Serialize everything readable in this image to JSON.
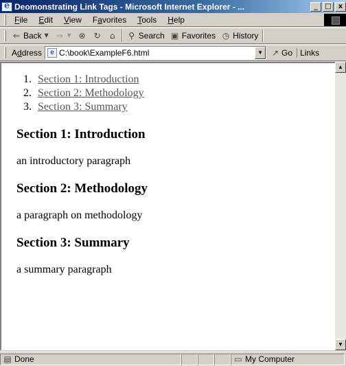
{
  "window": {
    "title": "Deomonstrating Link Tags - Microsoft Internet Explorer - ...",
    "controls": {
      "minimize": "_",
      "maximize": "□",
      "close": "x"
    }
  },
  "menu": {
    "items": [
      {
        "accel": "F",
        "rest": "ile"
      },
      {
        "accel": "E",
        "rest": "dit"
      },
      {
        "accel": "V",
        "rest": "iew"
      },
      {
        "pre": "F",
        "accel": "a",
        "rest": "vorites"
      },
      {
        "accel": "T",
        "rest": "ools"
      },
      {
        "accel": "H",
        "rest": "elp"
      }
    ]
  },
  "toolbar": {
    "back": "Back",
    "search": "Search",
    "favorites": "Favorites",
    "history": "History"
  },
  "address": {
    "label_accel": "d",
    "label_pre": "A",
    "label_rest": "dress",
    "value": "C:\\book\\ExampleF6.html",
    "go": "Go",
    "links": "Links"
  },
  "page": {
    "toc": [
      {
        "num": "1.",
        "label": "Section 1: Introduction"
      },
      {
        "num": "2.",
        "label": "Section 2: Methodology"
      },
      {
        "num": "3.",
        "label": "Section 3: Summary"
      }
    ],
    "sections": [
      {
        "heading": "Section 1: Introduction",
        "text": "an introductory paragraph"
      },
      {
        "heading": "Section 2: Methodology",
        "text": "a paragraph on methodology"
      },
      {
        "heading": "Section 3: Summary",
        "text": "a summary paragraph"
      }
    ]
  },
  "status": {
    "text": "Done",
    "zone": "My Computer"
  }
}
